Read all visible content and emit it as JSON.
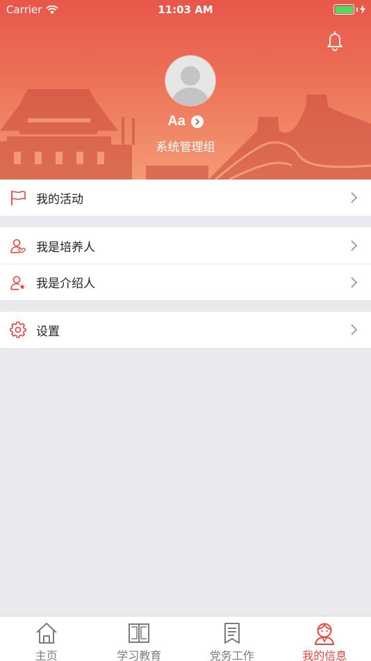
{
  "status_bar": {
    "carrier": "Carrier",
    "time": "11:03 AM"
  },
  "profile": {
    "name": "Aa",
    "group": "系统管理组"
  },
  "menu": {
    "activities": "我的活动",
    "cultivator": "我是培养人",
    "introducer": "我是介绍人",
    "settings": "设置"
  },
  "tabs": [
    {
      "label": "主页",
      "icon": "home-icon"
    },
    {
      "label": "学习教育",
      "icon": "book-icon"
    },
    {
      "label": "党务工作",
      "icon": "document-icon"
    },
    {
      "label": "我的信息",
      "icon": "profile-icon"
    }
  ],
  "colors": {
    "accent": "#e8453c",
    "header_top": "#e8574a",
    "header_bottom": "#f49a74",
    "tab_inactive": "#7b7b7b",
    "background": "#e9e9ee"
  }
}
